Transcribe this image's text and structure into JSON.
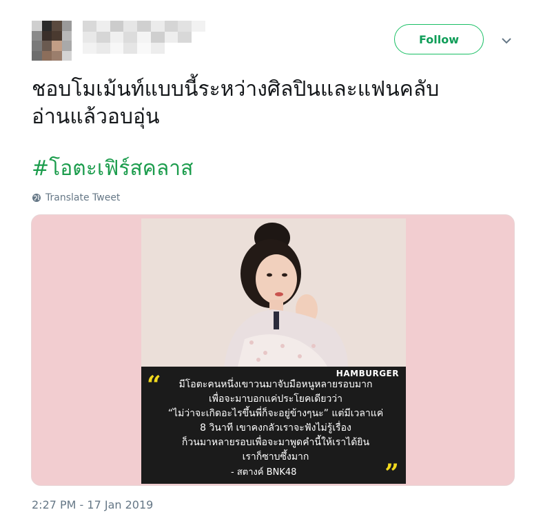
{
  "header": {
    "follow_label": "Follow",
    "colors": {
      "accent": "#17bf63",
      "follow_text": "#0f9d58"
    },
    "chevron_icon": "chevron-down-icon"
  },
  "tweet": {
    "lines": [
      "ชอบโมเม้นท์แบบนี้ระหว่างศิลปินและแฟนคลับ",
      "อ่านแล้วอบอุ่น"
    ],
    "hashtag": "#โอตะเฟิร์สคลาส",
    "translate_label": "Translate Tweet",
    "translate_icon": "globe-icon",
    "timestamp": "2:27 PM - 17 Jan 2019"
  },
  "media": {
    "brand": "HAMBURGER",
    "quote_lines": [
      "มีโอตะคนหนึ่งเขาวนมาจับมือหนูหลายรอบมาก",
      "เพื่อจะมาบอกแค่ประโยคเดียวว่า",
      "“ไม่ว่าจะเกิดอะไรขึ้นพี่ก็จะอยู่ข้างๆนะ” แต่มีเวลาแค่",
      "8 วินาที เขาคงกลัวเราจะฟังไม่รู้เรื่อง",
      "ก็วนมาหลายรอบเพื่อจะมาพูดคำนี้ให้เราได้ยิน",
      "เราก็ซาบซึ้งมาก"
    ],
    "quote_author": "- สตางค์ BNK48",
    "open_quote": "“",
    "close_quote": "”",
    "colors": {
      "background": "#f2cdd0",
      "caption_bg": "#1b1b1b",
      "quote_mark": "#f2d91e"
    }
  }
}
